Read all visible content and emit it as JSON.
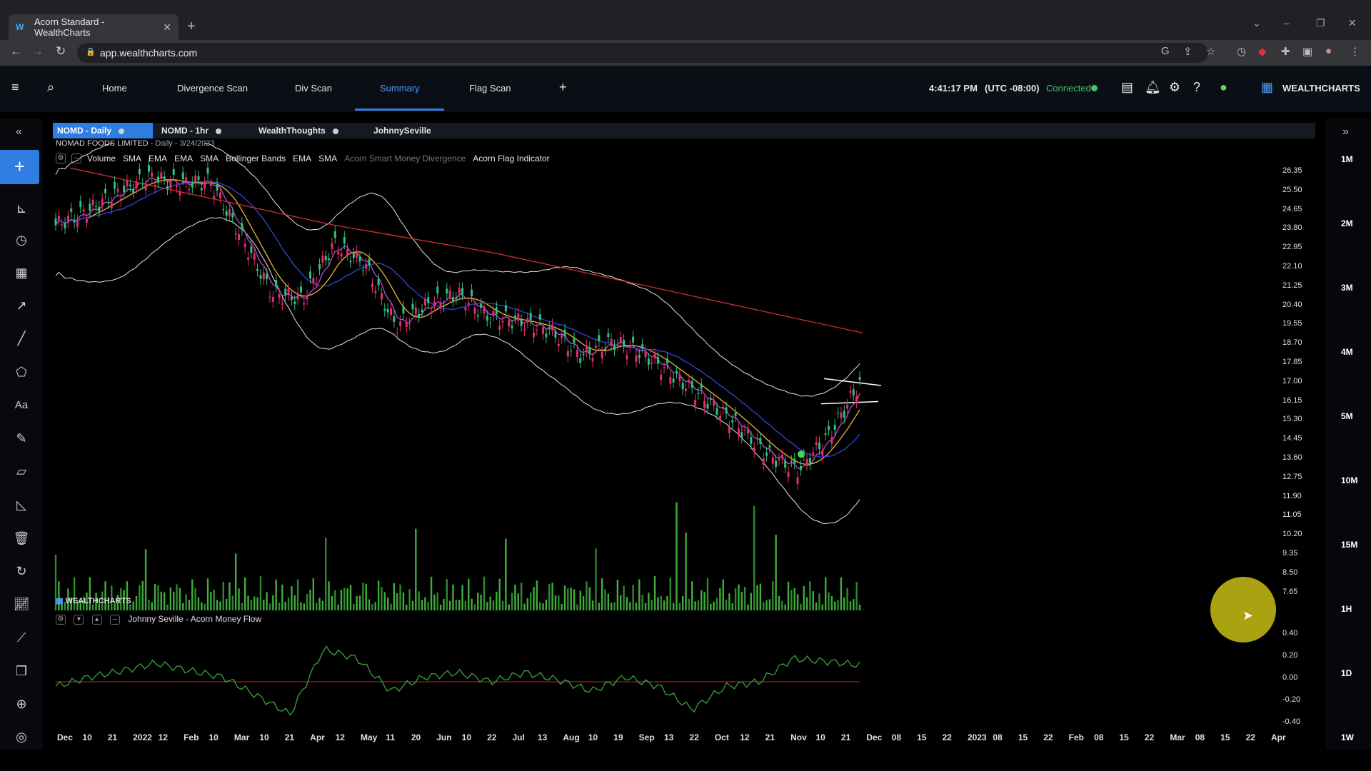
{
  "browser": {
    "tab_title": "Acorn Standard - WealthCharts",
    "url": "app.wealthcharts.com"
  },
  "header": {
    "nav": [
      "Home",
      "Divergence Scan",
      "Div Scan",
      "Summary",
      "Flag Scan"
    ],
    "active": "Summary",
    "time": "4:41:17 PM",
    "timezone": "(UTC -08:00)",
    "status": "Connected",
    "brand": "WEALTHCHARTS"
  },
  "chart_tabs": [
    "NOMD - Daily",
    "NOMD - 1hr",
    "WealthThoughts",
    "JohnnySeville"
  ],
  "chart_header": {
    "name": "NOMAD FOODS LIMITED",
    "detail": "- Daily - 3/24/2023"
  },
  "indicators": [
    "Volume",
    "SMA",
    "EMA",
    "EMA",
    "SMA",
    "Bollinger Bands",
    "EMA",
    "SMA",
    "Acorn Smart Money Divergence",
    "Acorn Flag Indicator"
  ],
  "watermark": "WEALTHCHARTS",
  "oscillator_title": "Johnny Seville - Acorn Money Flow",
  "price_axis": [
    "26.35",
    "25.50",
    "24.65",
    "23.80",
    "22.95",
    "22.10",
    "21.25",
    "20.40",
    "19.55",
    "18.70",
    "17.85",
    "17.00",
    "16.15",
    "15.30",
    "14.45",
    "13.60",
    "12.75",
    "11.90",
    "11.05",
    "10.20",
    "9.35",
    "8.50",
    "7.65"
  ],
  "osc_axis": [
    "0.40",
    "0.20",
    "0.00",
    "-0.20",
    "-0.40"
  ],
  "timeframes": [
    "1M",
    "2M",
    "3M",
    "4M",
    "5M",
    "10M",
    "15M",
    "1H",
    "1D",
    "1W"
  ],
  "date_axis": [
    "Dec",
    "10",
    "21",
    "2022",
    "12",
    "Feb",
    "10",
    "Mar",
    "10",
    "21",
    "Apr",
    "12",
    "May",
    "11",
    "20",
    "Jun",
    "10",
    "22",
    "Jul",
    "13",
    "Aug",
    "10",
    "19",
    "Sep",
    "13",
    "22",
    "Oct",
    "12",
    "21",
    "Nov",
    "10",
    "21",
    "Dec",
    "08",
    "15",
    "22",
    "2023",
    "08",
    "15",
    "22",
    "Feb",
    "08",
    "15",
    "22",
    "Mar",
    "08",
    "15",
    "22",
    "Apr"
  ],
  "chart_data": {
    "type": "line",
    "title": "NOMAD FOODS LIMITED",
    "ylim": [
      7.65,
      26.35
    ],
    "series": [
      {
        "values": [
          24.0,
          24.6,
          25.4,
          26.1,
          25.8,
          25.9,
          23.5,
          21.0,
          20.8,
          23.2,
          22.3,
          19.6,
          20.5,
          21.0,
          20.0,
          19.8,
          19.4,
          18.3,
          18.9,
          18.4,
          17.4,
          16.4,
          15.3,
          14.0,
          13.3,
          14.8,
          17.1
        ]
      },
      {
        "name": "SMA",
        "values": [
          26.5,
          26.0,
          25.5,
          25.0,
          24.5,
          24.0,
          23.6,
          23.2,
          22.8,
          22.3,
          21.8,
          21.3,
          20.8,
          20.3,
          19.8,
          19.3
        ]
      }
    ],
    "oscillator": {
      "values": [
        -0.05,
        0.05,
        0.12,
        0.2,
        0.12,
        0.05,
        -0.15,
        -0.35,
        0.35,
        0.25,
        -0.1,
        0.05,
        0.1,
        0.0,
        0.1,
        0.02,
        -0.1,
        0.05,
        -0.05,
        -0.3,
        -0.05,
        0.0,
        0.25,
        0.22,
        0.18
      ]
    }
  }
}
